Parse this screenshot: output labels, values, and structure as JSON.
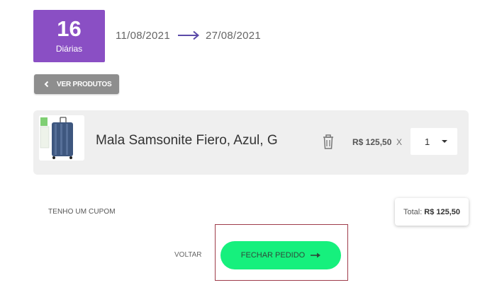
{
  "booking": {
    "days_count": "16",
    "days_label": "Diárias",
    "start_date": "11/08/2021",
    "end_date": "27/08/2021"
  },
  "nav": {
    "back_products_label": "VER PRODUTOS"
  },
  "cart": {
    "items": [
      {
        "name": "Mala Samsonite Fiero, Azul, G",
        "price": "R$ 125,50",
        "multiplier": "X",
        "quantity": "1"
      }
    ]
  },
  "footer": {
    "coupon_label": "TENHO UM CUPOM",
    "total_label": "Total:",
    "total_value": "R$ 125,50",
    "back_label": "VOLTAR",
    "checkout_label": "FECHAR PEDIDO"
  },
  "colors": {
    "accent_purple": "#8a4fc4",
    "checkout_green": "#16f07d",
    "card_bg": "#efefef"
  }
}
